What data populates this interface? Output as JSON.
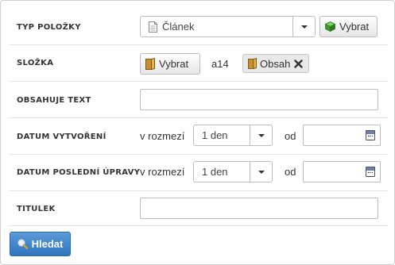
{
  "form": {
    "item_type": {
      "label": "TYP POLOŽKY",
      "selected": "Článek",
      "select_button": "Vybrat",
      "icons": {
        "document": "document-icon",
        "cube": "green-cube-icon"
      }
    },
    "folder": {
      "label": "SLOŽKA",
      "select_button": "Vybrat",
      "value": "a14",
      "tag_label": "Obsah",
      "icons": {
        "folder": "folder-icon",
        "remove": "close-icon"
      }
    },
    "contains_text": {
      "label": "OBSAHUJE TEXT",
      "value": ""
    },
    "created": {
      "label": "DATUM VYTVOŘENÍ",
      "range_label": "v rozmezí",
      "range_value": "1 den",
      "from_label": "od",
      "date_value": ""
    },
    "modified": {
      "label": "DATUM POSLEDNÍ ÚPRAVY",
      "range_label": "v rozmezí",
      "range_value": "1 den",
      "from_label": "od",
      "date_value": ""
    },
    "title": {
      "label": "TITULEK",
      "value": ""
    },
    "search_button": "Hledat"
  },
  "colors": {
    "primary_button": "#337ab7",
    "border": "#cfcfcf"
  }
}
